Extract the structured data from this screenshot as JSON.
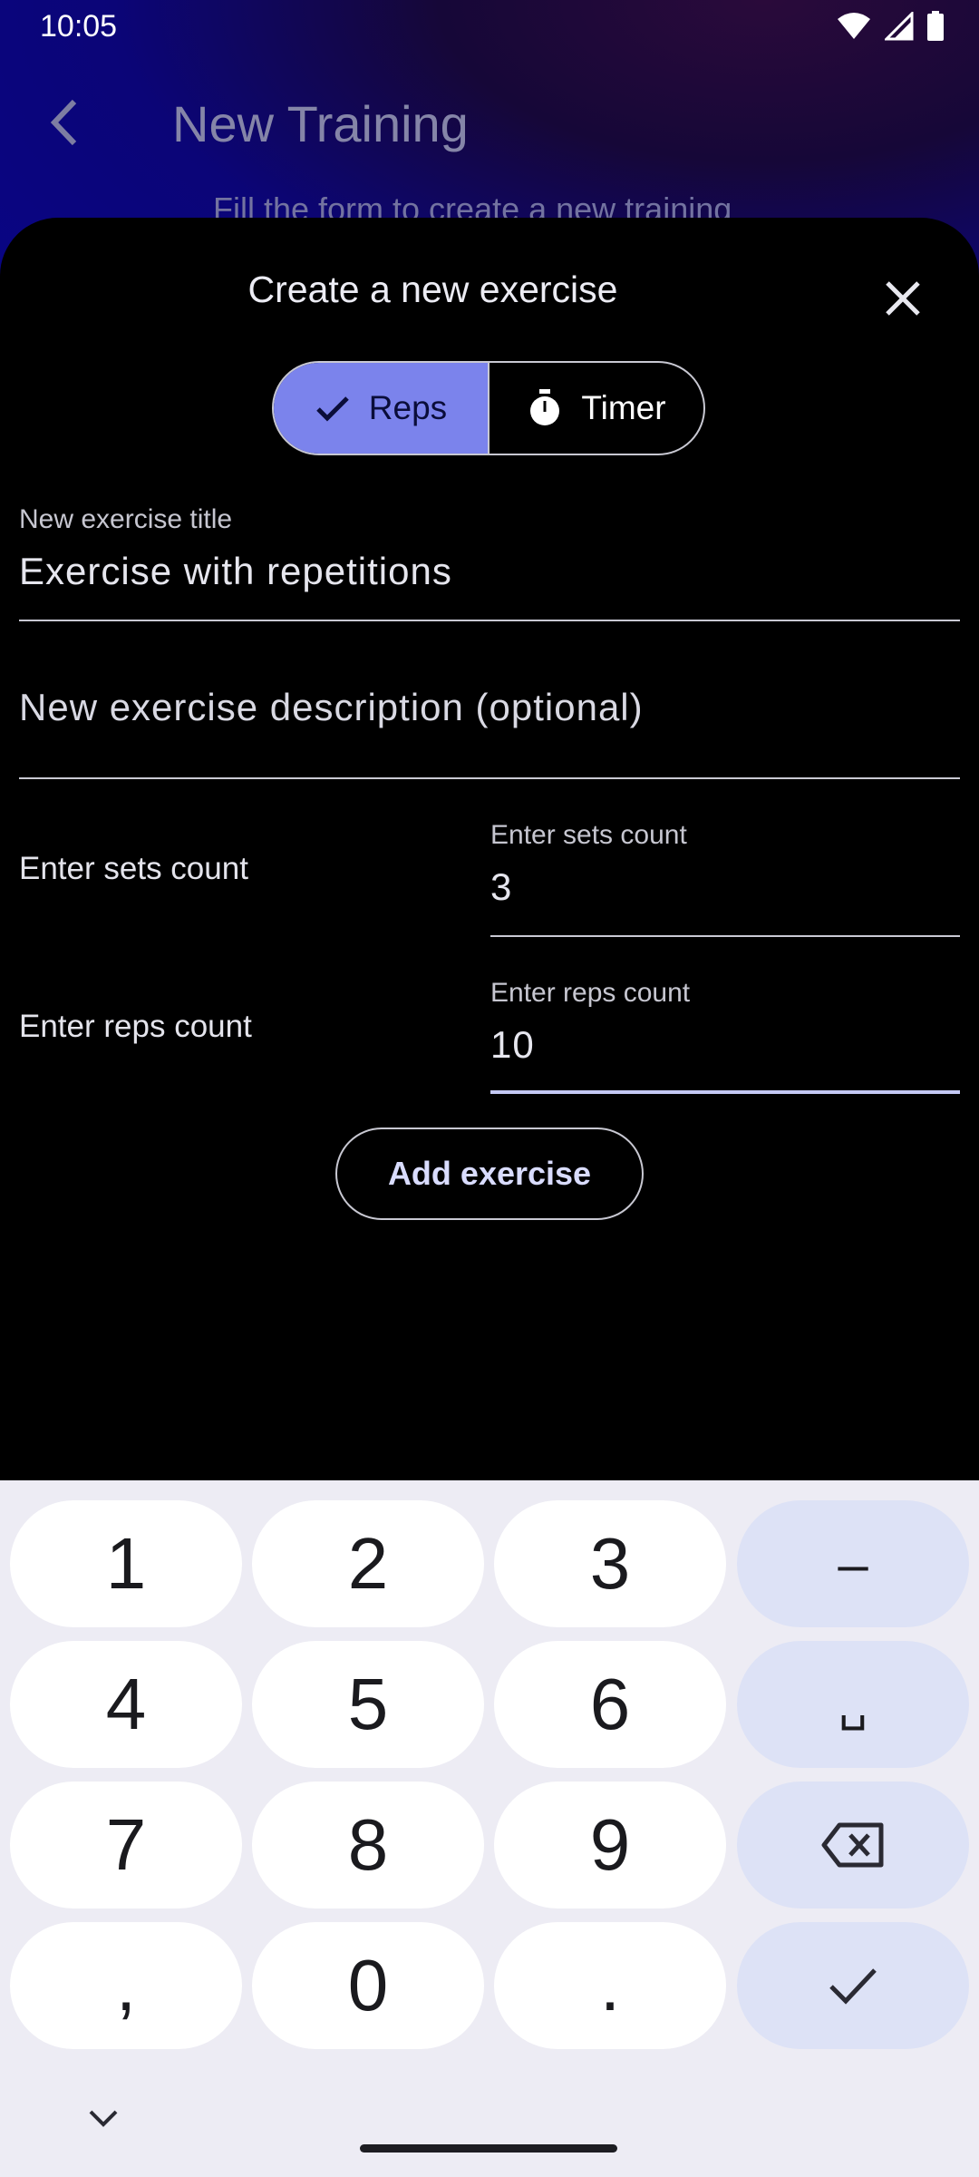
{
  "status_bar": {
    "time": "10:05"
  },
  "background_screen": {
    "title": "New Training",
    "subtitle": "Fill the form to create a new training"
  },
  "sheet": {
    "title": "Create a new exercise",
    "mode_toggle": {
      "reps_label": "Reps",
      "timer_label": "Timer",
      "selected": "Reps"
    },
    "title_field": {
      "label": "New exercise title",
      "value": "Exercise with repetitions"
    },
    "description_field": {
      "placeholder": "New exercise description (optional)"
    },
    "sets_row": {
      "label": "Enter sets count",
      "field_label": "Enter sets count",
      "value": "3"
    },
    "reps_row": {
      "label": "Enter reps count",
      "field_label": "Enter reps count",
      "value": "10"
    },
    "add_button": "Add exercise"
  },
  "keyboard": {
    "keys": [
      "1",
      "2",
      "3",
      "–",
      "4",
      "5",
      "6",
      "␣",
      "7",
      "8",
      "9",
      "⌫",
      ",",
      "0",
      ".",
      "✓"
    ]
  },
  "colors": {
    "accent": "#7b83ec",
    "sheet_bg": "#000000",
    "keyboard_bg": "#edecf4"
  }
}
